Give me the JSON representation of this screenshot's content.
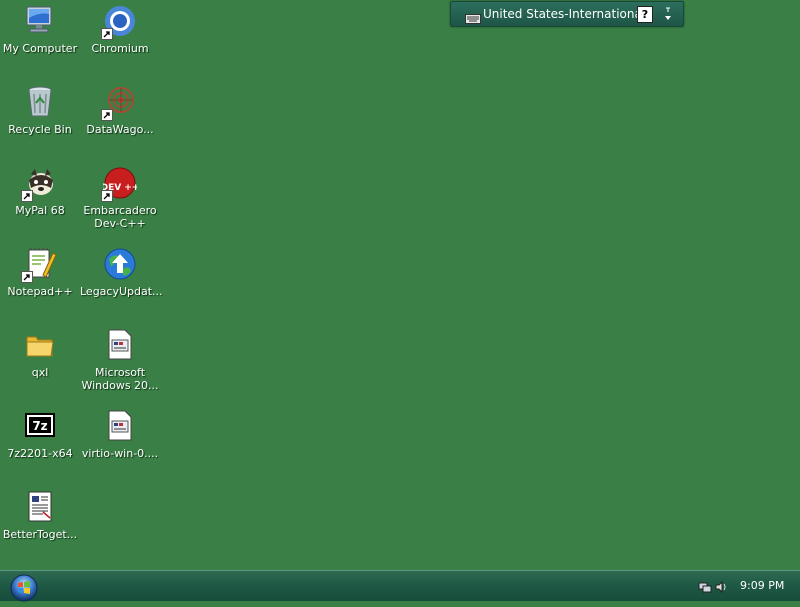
{
  "desktop": {
    "icons": [
      {
        "label": "My Computer",
        "icon": "computer-icon"
      },
      {
        "label": "Chromium",
        "icon": "chromium-icon"
      },
      {
        "label": "Recycle Bin",
        "icon": "recycle-bin-icon"
      },
      {
        "label": "DataWago...",
        "icon": "datawagon-icon"
      },
      {
        "label": "MyPal 68",
        "icon": "mypal-icon"
      },
      {
        "label": "Embarcadero Dev-C++",
        "icon": "devcpp-icon",
        "badge_text": "DEV ++"
      },
      {
        "label": "Notepad++",
        "icon": "notepadpp-icon"
      },
      {
        "label": "LegacyUpdat...",
        "icon": "legacyupdate-icon"
      },
      {
        "label": "qxl",
        "icon": "folder-icon"
      },
      {
        "label": "Microsoft Windows 20...",
        "icon": "document-icon"
      },
      {
        "label": "7z2201-x64",
        "icon": "7zip-icon",
        "badge_text": "7z"
      },
      {
        "label": "virtio-win-0....",
        "icon": "document-icon"
      },
      {
        "label": "BetterToget...",
        "icon": "text-document-icon"
      }
    ]
  },
  "language_bar": {
    "language": "United States-International",
    "help_label": "?",
    "keyboard_icon": "keyboard-icon",
    "options_icon": "options-arrow-icon"
  },
  "taskbar": {
    "start_icon": "windows-orb-icon",
    "clock": "9:09 PM",
    "tray_icons": [
      "network-icon",
      "volume-icon"
    ]
  },
  "colors": {
    "desktop_background": "#3a8046",
    "taskbar": "#1f5a45",
    "label_text": "#ffffff"
  }
}
